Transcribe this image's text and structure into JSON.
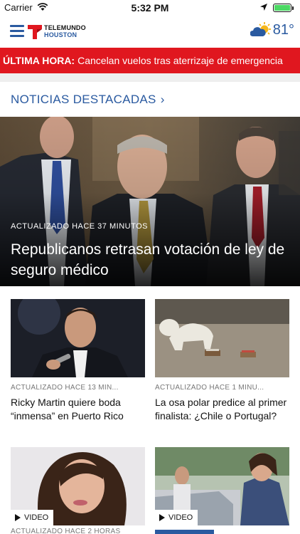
{
  "status_bar": {
    "carrier": "Carrier",
    "time": "5:32 PM",
    "battery_level": 1.0
  },
  "header": {
    "menu_icon": "hamburger-menu-icon",
    "logo_line1": "TELEMUNDO",
    "logo_line2": "HOUSTON",
    "weather_icon": "partly-cloudy-icon",
    "temperature": "81°"
  },
  "breaking": {
    "label": "ÚLTIMA HORA:",
    "headline": "Cancelan vuelos tras aterrizaje de emergencia"
  },
  "section": {
    "title": "NOTICIAS DESTACADAS",
    "chevron": "›"
  },
  "hero": {
    "meta": "ACTUALIZADO HACE 37 MINUTOS",
    "title": "Republicanos retrasan votación de ley de seguro médico"
  },
  "cards": [
    {
      "meta": "ACTUALIZADO HACE 13 MIN...",
      "title": "Ricky Martin quiere boda “inmensa” en Puerto Rico"
    },
    {
      "meta": "ACTUALIZADO HACE 1 MINU...",
      "title": "La osa polar predice al primer finalista: ¿Chile o Portugal?"
    },
    {
      "video_label": "VIDEO"
    },
    {
      "video_label": "VIDEO"
    }
  ],
  "partial_meta": "ACTUALIZADO HACE 2 HORAS",
  "colors": {
    "brand_blue": "#2a5aa0",
    "breaking_red": "#e0171f",
    "logo_red": "#e0171f"
  }
}
